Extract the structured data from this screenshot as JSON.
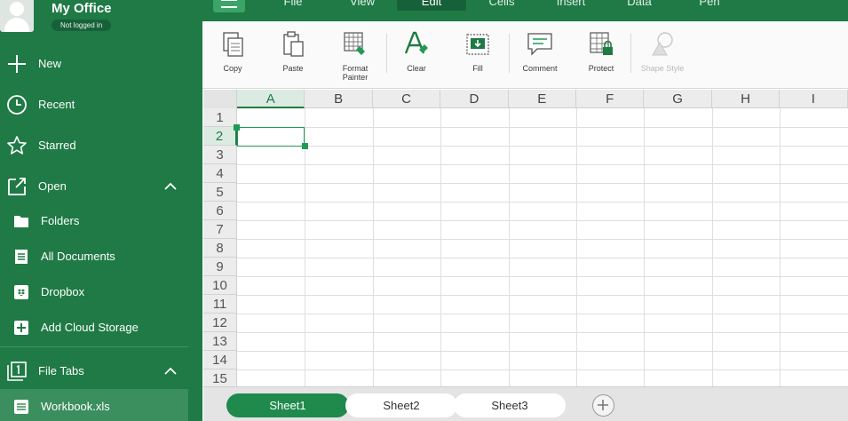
{
  "sidebar": {
    "app_title": "My Office",
    "login_status": "Not logged in",
    "items": [
      {
        "label": "New"
      },
      {
        "label": "Recent"
      },
      {
        "label": "Starred"
      },
      {
        "label": "Open"
      },
      {
        "label": "Folders"
      },
      {
        "label": "All Documents"
      },
      {
        "label": "Dropbox"
      },
      {
        "label": "Add Cloud Storage"
      },
      {
        "label": "File Tabs"
      },
      {
        "label": "Workbook.xls"
      }
    ]
  },
  "tabs": [
    {
      "label": "File"
    },
    {
      "label": "View"
    },
    {
      "label": "Edit"
    },
    {
      "label": "Cells"
    },
    {
      "label": "Insert"
    },
    {
      "label": "Data"
    },
    {
      "label": "Pen"
    }
  ],
  "ribbon": {
    "copy": "Copy",
    "paste": "Paste",
    "format_painter_1": "Format",
    "format_painter_2": "Painter",
    "clear": "Clear",
    "fill": "Fill",
    "comment": "Comment",
    "protect": "Protect",
    "shape_style": "Shape Style"
  },
  "grid": {
    "columns": [
      "A",
      "B",
      "C",
      "D",
      "E",
      "F",
      "G",
      "H",
      "I"
    ],
    "rows": [
      "1",
      "2",
      "3",
      "4",
      "5",
      "6",
      "7",
      "8",
      "9",
      "10",
      "11",
      "12",
      "13",
      "14",
      "15"
    ],
    "selected_column": "A",
    "selected_row": "2"
  },
  "sheets": [
    {
      "label": "Sheet1"
    },
    {
      "label": "Sheet2"
    },
    {
      "label": "Sheet3"
    }
  ],
  "colors": {
    "brand_green": "#1f7a45",
    "accent_green": "#1f9a55"
  }
}
